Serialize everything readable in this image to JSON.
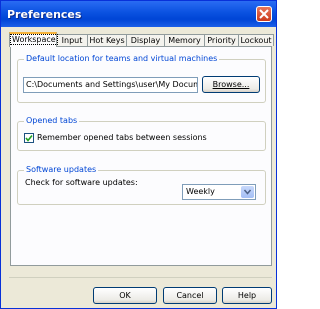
{
  "window": {
    "title": "Preferences"
  },
  "tabs": [
    "Workspace",
    "Input",
    "Hot Keys",
    "Display",
    "Memory",
    "Priority",
    "Lockout"
  ],
  "workspace": {
    "default_location": {
      "title": "Default location for teams and virtual machines",
      "value": "C:\\Documents and Settings\\user\\My Docume",
      "browse_label": "Browse..."
    },
    "opened_tabs": {
      "title": "Opened tabs",
      "checkbox_label": "Remember opened tabs between sessions",
      "checked": true
    },
    "software_updates": {
      "title": "Software updates",
      "label": "Check for software updates:",
      "selected": "Weekly"
    }
  },
  "footer": {
    "ok": "OK",
    "cancel": "Cancel",
    "help": "Help"
  },
  "colors": {
    "titlebar": "#0a51e0",
    "group_title": "#0046d5",
    "active_tab_accent": "#f8b43c"
  }
}
